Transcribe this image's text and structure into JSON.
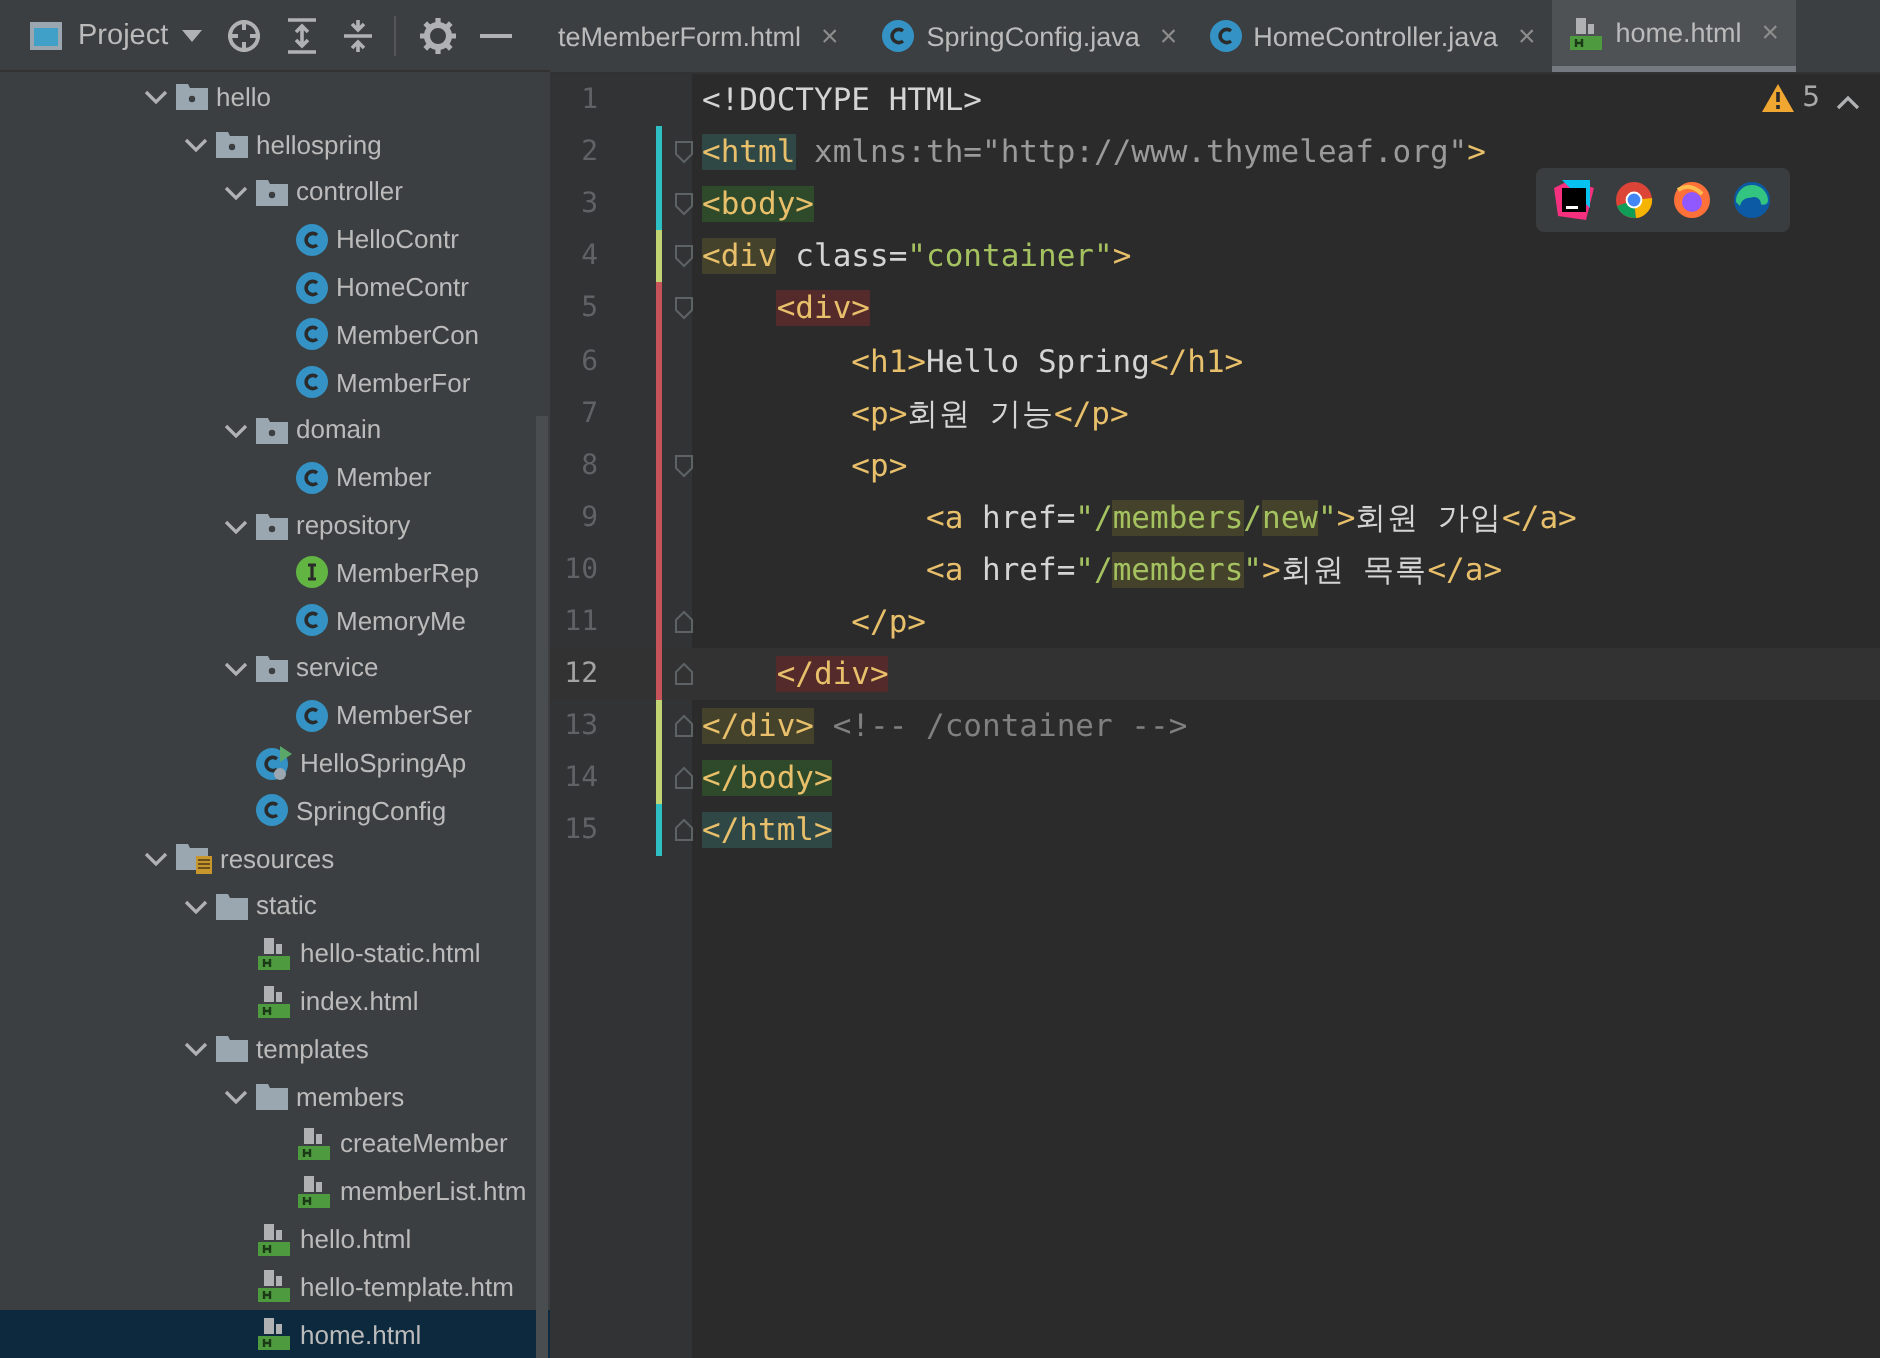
{
  "project_panel": {
    "title": "Project"
  },
  "tree": {
    "items": [
      {
        "label": "hello",
        "kind": "package",
        "expanded": true,
        "selected": false,
        "children": [
          {
            "label": "hellospring",
            "kind": "package",
            "expanded": true,
            "selected": false,
            "children": [
              {
                "label": "controller",
                "kind": "package",
                "expanded": true,
                "selected": false,
                "children": [
                  {
                    "label": "HelloContr",
                    "kind": "class",
                    "selected": false
                  },
                  {
                    "label": "HomeContr",
                    "kind": "class",
                    "selected": false
                  },
                  {
                    "label": "MemberCon",
                    "kind": "class",
                    "selected": false
                  },
                  {
                    "label": "MemberFor",
                    "kind": "class",
                    "selected": false
                  }
                ]
              },
              {
                "label": "domain",
                "kind": "package",
                "expanded": true,
                "selected": false,
                "children": [
                  {
                    "label": "Member",
                    "kind": "class",
                    "selected": false
                  }
                ]
              },
              {
                "label": "repository",
                "kind": "package",
                "expanded": true,
                "selected": false,
                "children": [
                  {
                    "label": "MemberRep",
                    "kind": "interface",
                    "selected": false
                  },
                  {
                    "label": "MemoryMe",
                    "kind": "class",
                    "selected": false
                  }
                ]
              },
              {
                "label": "service",
                "kind": "package",
                "expanded": true,
                "selected": false,
                "children": [
                  {
                    "label": "MemberSer",
                    "kind": "class",
                    "selected": false
                  }
                ]
              },
              {
                "label": "HelloSpringAp",
                "kind": "app",
                "selected": false
              },
              {
                "label": "SpringConfig",
                "kind": "class",
                "selected": false
              }
            ]
          }
        ]
      },
      {
        "label": "resources",
        "kind": "resources",
        "expanded": true,
        "selected": false,
        "children": [
          {
            "label": "static",
            "kind": "folder",
            "expanded": true,
            "selected": false,
            "children": [
              {
                "label": "hello-static.html",
                "kind": "html",
                "selected": false
              },
              {
                "label": "index.html",
                "kind": "html",
                "selected": false
              }
            ]
          },
          {
            "label": "templates",
            "kind": "folder",
            "expanded": true,
            "selected": false,
            "children": [
              {
                "label": "members",
                "kind": "folder",
                "expanded": true,
                "selected": false,
                "children": [
                  {
                    "label": "createMember",
                    "kind": "html",
                    "selected": false
                  },
                  {
                    "label": "memberList.htm",
                    "kind": "html",
                    "selected": false
                  }
                ]
              },
              {
                "label": "hello.html",
                "kind": "html",
                "selected": false
              },
              {
                "label": "hello-template.htm",
                "kind": "html",
                "selected": false
              },
              {
                "label": "home.html",
                "kind": "html",
                "selected": true
              }
            ]
          }
        ]
      }
    ]
  },
  "tabs": [
    {
      "label": "teMemberForm.html",
      "kind": "plain",
      "close": "×",
      "selected": false
    },
    {
      "label": "SpringConfig.java",
      "kind": "class",
      "close": "×",
      "selected": false
    },
    {
      "label": "HomeController.java",
      "kind": "class",
      "close": "×",
      "selected": false
    },
    {
      "label": "home.html",
      "kind": "html",
      "close": "×",
      "selected": true
    }
  ],
  "editor": {
    "warnings": "5",
    "lines": [
      {
        "number": "1",
        "kind": "plain",
        "current": false,
        "tokens": [
          {
            "kind": "text",
            "text": "<!DOCTYPE HTML>"
          }
        ]
      },
      {
        "number": "2",
        "kind": "open",
        "color": "#2ebfc4",
        "current": false,
        "tokens": [
          {
            "kind": "tag-teal",
            "text": "<html"
          },
          {
            "kind": "attr",
            "text": " xmlns:th=\"http://www.thymeleaf.org\""
          },
          {
            "kind": "tag",
            "text": ">"
          }
        ]
      },
      {
        "number": "3",
        "kind": "open",
        "color": "#2ebfc4",
        "current": false,
        "tokens": [
          {
            "kind": "tag-green",
            "text": "<body>"
          }
        ]
      },
      {
        "number": "4",
        "kind": "open",
        "color": "#c0d474",
        "current": false,
        "tokens": [
          {
            "kind": "tag-olive",
            "text": "<div"
          },
          {
            "kind": "text",
            "text": " class="
          },
          {
            "kind": "value",
            "text": "\"container\""
          },
          {
            "kind": "tag",
            "text": ">"
          }
        ]
      },
      {
        "number": "5",
        "kind": "open",
        "color": "#c7535a",
        "current": false,
        "tokens": [
          {
            "kind": "tag-red",
            "text": "    <div>"
          }
        ]
      },
      {
        "number": "6",
        "kind": "plain",
        "color": "#c7535a",
        "current": false,
        "tokens": [
          {
            "kind": "tag",
            "text": "        <h1>"
          },
          {
            "kind": "text",
            "text": "Hello Spring"
          },
          {
            "kind": "tag",
            "text": "</h1>"
          }
        ]
      },
      {
        "number": "7",
        "kind": "plain",
        "color": "#c7535a",
        "current": false,
        "tokens": [
          {
            "kind": "tag",
            "text": "        <p>"
          },
          {
            "kind": "text",
            "text": "회원 기능"
          },
          {
            "kind": "tag",
            "text": "</p>"
          }
        ]
      },
      {
        "number": "8",
        "kind": "open",
        "color": "#c7535a",
        "current": false,
        "tokens": [
          {
            "kind": "tag",
            "text": "        <p>"
          }
        ]
      },
      {
        "number": "9",
        "kind": "plain",
        "color": "#c7535a",
        "current": false,
        "tokens": [
          {
            "kind": "tag",
            "text": "            <a"
          },
          {
            "kind": "text",
            "text": " href="
          },
          {
            "kind": "value",
            "text": "\"/"
          },
          {
            "kind": "value-olive",
            "text": "members"
          },
          {
            "kind": "value",
            "text": "/"
          },
          {
            "kind": "value-olive",
            "text": "new"
          },
          {
            "kind": "value",
            "text": "\""
          },
          {
            "kind": "tag",
            "text": ">"
          },
          {
            "kind": "text",
            "text": "회원 가입"
          },
          {
            "kind": "tag",
            "text": "</a>"
          }
        ]
      },
      {
        "number": "10",
        "kind": "plain",
        "color": "#c7535a",
        "current": false,
        "tokens": [
          {
            "kind": "tag",
            "text": "            <a"
          },
          {
            "kind": "text",
            "text": " href="
          },
          {
            "kind": "value",
            "text": "\"/"
          },
          {
            "kind": "value-olive",
            "text": "members"
          },
          {
            "kind": "value",
            "text": "\""
          },
          {
            "kind": "tag",
            "text": ">"
          },
          {
            "kind": "text",
            "text": "회원 목록"
          },
          {
            "kind": "tag",
            "text": "</a>"
          }
        ]
      },
      {
        "number": "11",
        "kind": "close",
        "color": "#c7535a",
        "current": false,
        "tokens": [
          {
            "kind": "tag",
            "text": "        </p>"
          }
        ]
      },
      {
        "number": "12",
        "kind": "close",
        "color": "#c7535a",
        "current": true,
        "tokens": [
          {
            "kind": "tag-red",
            "text": "    </div>"
          }
        ]
      },
      {
        "number": "13",
        "kind": "close",
        "color": "#c0d474",
        "current": false,
        "tokens": [
          {
            "kind": "tag-olive",
            "text": "</div>"
          },
          {
            "kind": "comment",
            "text": " <!-- /container -->"
          }
        ]
      },
      {
        "number": "14",
        "kind": "close",
        "color": "#c0d474",
        "current": false,
        "tokens": [
          {
            "kind": "tag-green",
            "text": "</body>"
          }
        ]
      },
      {
        "number": "15",
        "kind": "close",
        "color": "#2ebfc4",
        "current": false,
        "tokens": [
          {
            "kind": "tag-teal",
            "text": "</html>"
          }
        ]
      }
    ]
  }
}
